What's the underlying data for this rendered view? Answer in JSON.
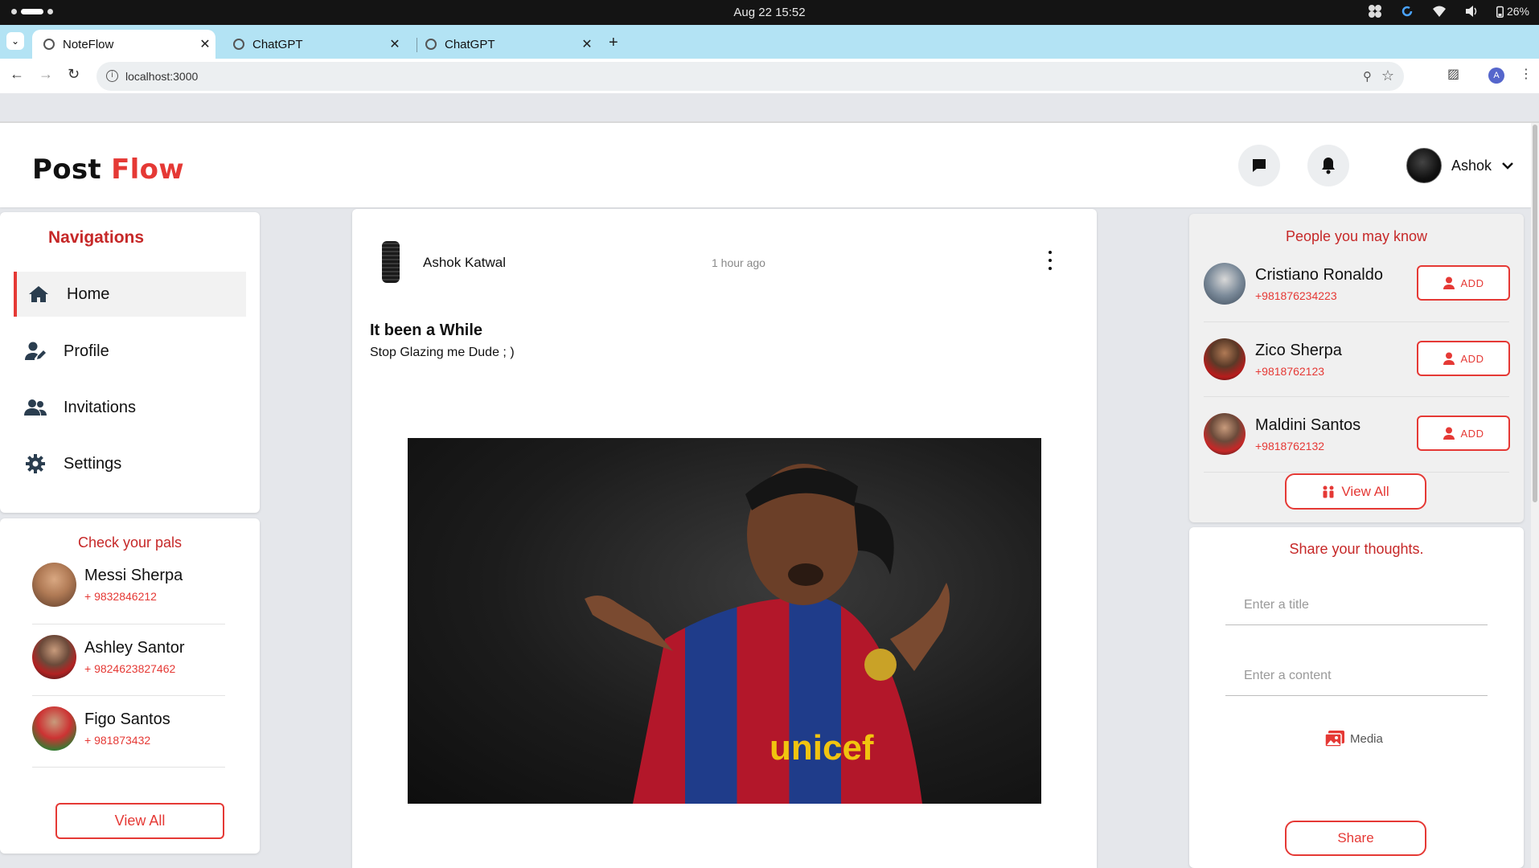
{
  "os": {
    "datetime": "Aug 22  15:52",
    "battery": "26%"
  },
  "browser": {
    "tabs": [
      {
        "title": "NoteFlow"
      },
      {
        "title": "ChatGPT"
      },
      {
        "title": "ChatGPT"
      }
    ],
    "url": "localhost:3000",
    "account_initial": "A"
  },
  "header": {
    "logo_part1": "Post ",
    "logo_part2": "Flow",
    "user_name": "Ashok"
  },
  "navigation": {
    "heading": "Navigations",
    "items": [
      {
        "label": "Home",
        "icon": "home-icon"
      },
      {
        "label": "Profile",
        "icon": "user-edit-icon"
      },
      {
        "label": "Invitations",
        "icon": "users-icon"
      },
      {
        "label": "Settings",
        "icon": "gear-icon"
      }
    ]
  },
  "pals": {
    "heading": "Check your pals",
    "items": [
      {
        "name": "Messi Sherpa",
        "phone": "+ 9832846212"
      },
      {
        "name": "Ashley Santor",
        "phone": "+ 9824623827462"
      },
      {
        "name": "Figo Santos",
        "phone": "+ 981873432"
      }
    ],
    "view_all": "View All"
  },
  "post": {
    "author": "Ashok Katwal",
    "time": "1 hour ago",
    "title": "It been a While",
    "body": "Stop Glazing me Dude ; )"
  },
  "suggestions": {
    "heading": "People you may know",
    "items": [
      {
        "name": "Cristiano Ronaldo",
        "phone": "+981876234223",
        "action": "ADD"
      },
      {
        "name": "Zico Sherpa",
        "phone": "+9818762123",
        "action": "ADD"
      },
      {
        "name": "Maldini Santos",
        "phone": "+9818762132",
        "action": "ADD"
      }
    ],
    "view_all": "View All"
  },
  "share": {
    "heading": "Share your thoughts.",
    "title_placeholder": "Enter a title",
    "content_placeholder": "Enter a content",
    "media_label": "Media",
    "share_label": "Share"
  },
  "colors": {
    "accent": "#e53935",
    "heading_red": "#c62828",
    "tab_strip": "#b3e3f4"
  }
}
